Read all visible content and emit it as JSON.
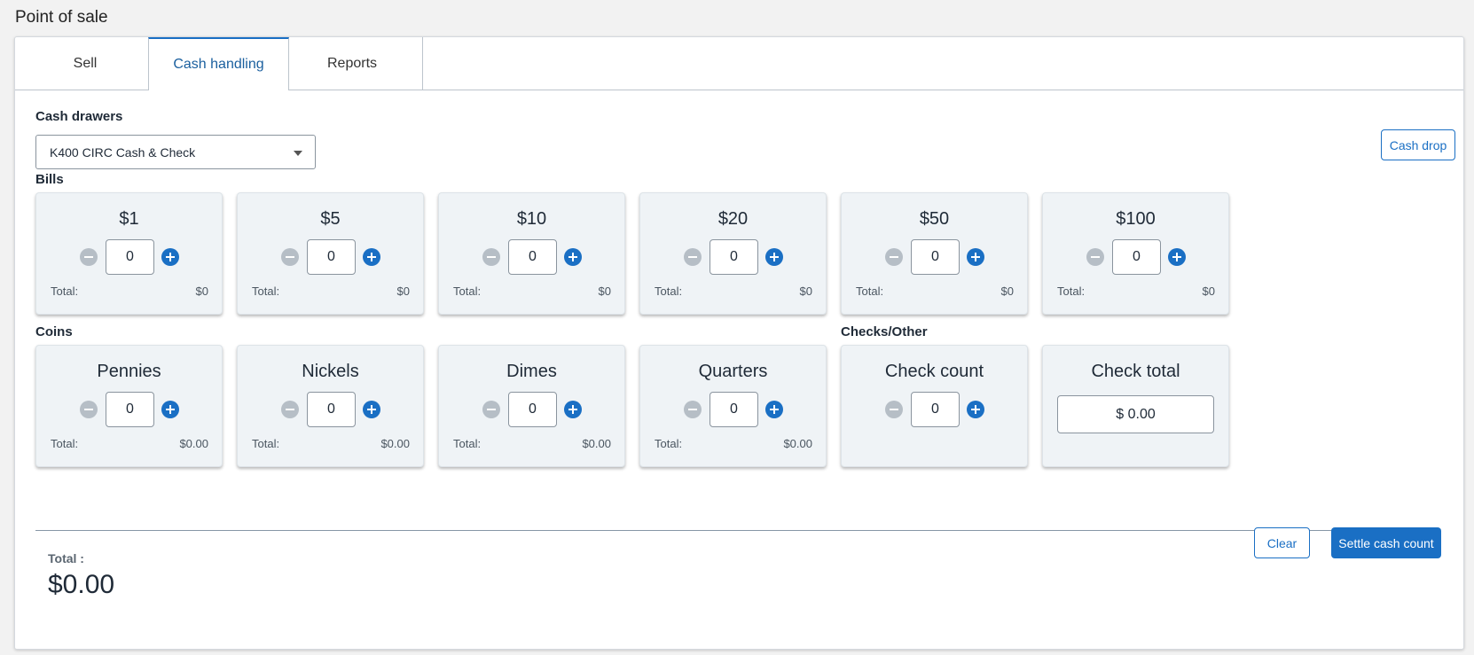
{
  "page": {
    "title": "Point of sale"
  },
  "tabs": [
    {
      "label": "Sell",
      "active": false
    },
    {
      "label": "Cash handling",
      "active": true
    },
    {
      "label": "Reports",
      "active": false
    }
  ],
  "cash_drawers": {
    "label": "Cash drawers",
    "selected": "K400 CIRC Cash & Check"
  },
  "cash_drop_label": "Cash drop",
  "bills": {
    "label": "Bills",
    "items": [
      {
        "title": "$1",
        "count": "0",
        "total_label": "Total:",
        "total": "$0"
      },
      {
        "title": "$5",
        "count": "0",
        "total_label": "Total:",
        "total": "$0"
      },
      {
        "title": "$10",
        "count": "0",
        "total_label": "Total:",
        "total": "$0"
      },
      {
        "title": "$20",
        "count": "0",
        "total_label": "Total:",
        "total": "$0"
      },
      {
        "title": "$50",
        "count": "0",
        "total_label": "Total:",
        "total": "$0"
      },
      {
        "title": "$100",
        "count": "0",
        "total_label": "Total:",
        "total": "$0"
      }
    ]
  },
  "coins": {
    "label": "Coins",
    "items": [
      {
        "title": "Pennies",
        "count": "0",
        "total_label": "Total:",
        "total": "$0.00"
      },
      {
        "title": "Nickels",
        "count": "0",
        "total_label": "Total:",
        "total": "$0.00"
      },
      {
        "title": "Dimes",
        "count": "0",
        "total_label": "Total:",
        "total": "$0.00"
      },
      {
        "title": "Quarters",
        "count": "0",
        "total_label": "Total:",
        "total": "$0.00"
      }
    ]
  },
  "checks": {
    "label": "Checks/Other",
    "count_title": "Check count",
    "count": "0",
    "total_title": "Check total",
    "total_value": "$ 0.00"
  },
  "summary": {
    "total_label": "Total :",
    "total_value": "$0.00"
  },
  "actions": {
    "clear_label": "Clear",
    "settle_label": "Settle cash count"
  },
  "colors": {
    "accent": "#1a6fc4",
    "card_bg": "#eff3f6",
    "minus_disabled": "#b6bec6"
  }
}
